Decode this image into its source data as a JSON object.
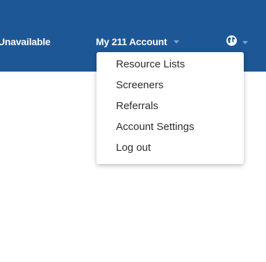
{
  "topbar": {
    "background_color": "#1d5796",
    "status_label": "Unavailable",
    "account_label": "My 211 Account",
    "language_icon": "globe-icon"
  },
  "account_menu": {
    "items": [
      {
        "label": "Resource Lists"
      },
      {
        "label": "Screeners"
      },
      {
        "label": "Referrals"
      },
      {
        "label": "Account Settings"
      },
      {
        "label": "Log out"
      }
    ]
  }
}
